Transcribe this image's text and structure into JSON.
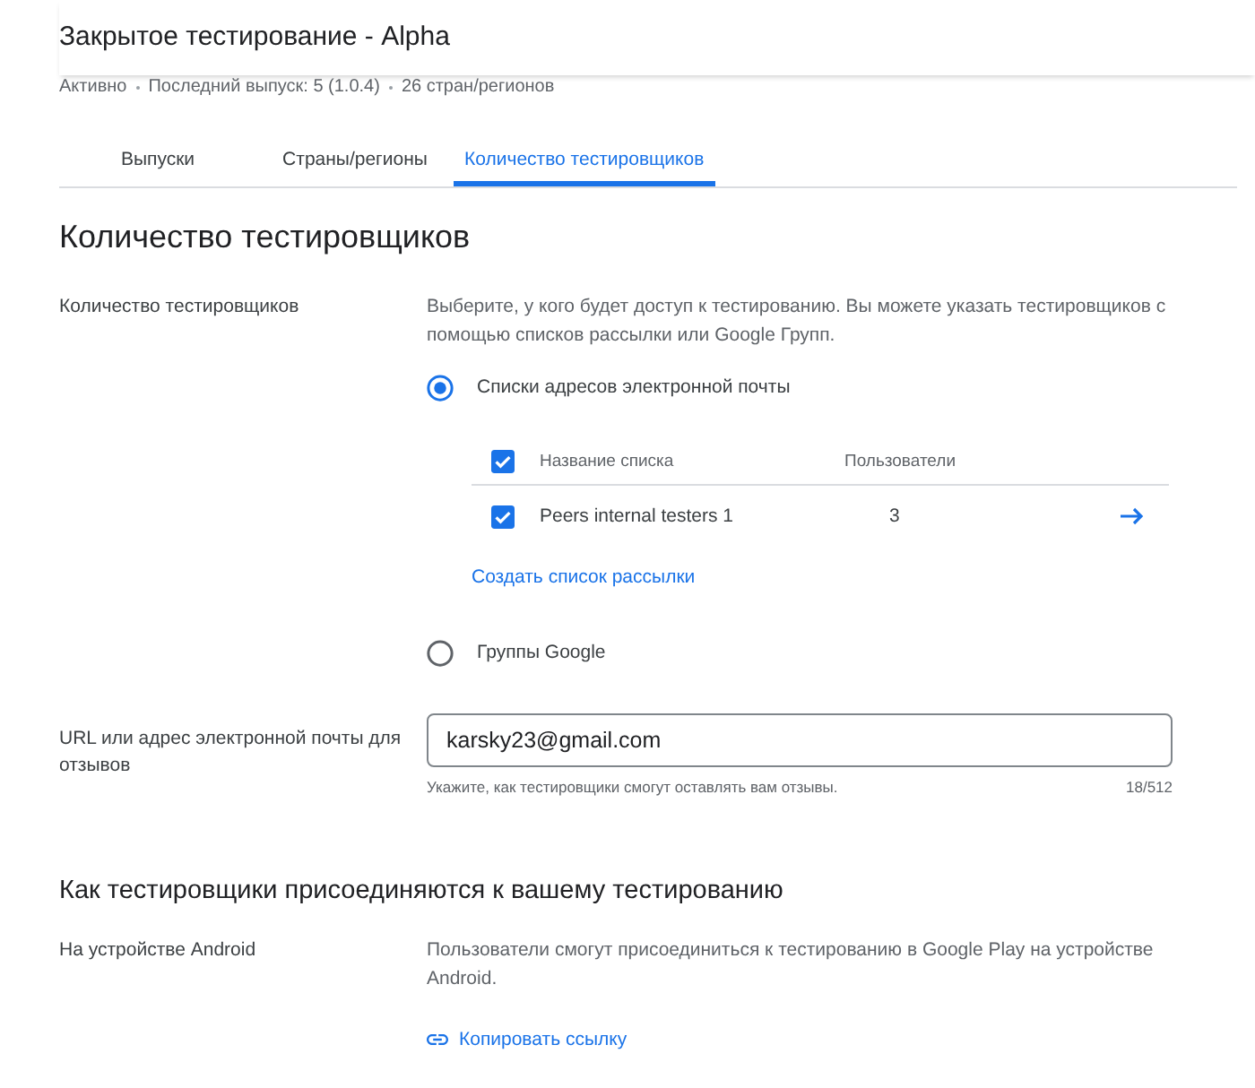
{
  "header": {
    "title": "Закрытое тестирование - Alpha",
    "meta": [
      "Активно",
      "Последний выпуск: 5 (1.0.4)",
      "26 стран/регионов"
    ]
  },
  "tabs": [
    {
      "label": "Выпуски",
      "selected": false
    },
    {
      "label": "Страны/регионы",
      "selected": false
    },
    {
      "label": "Количество тестировщиков",
      "selected": true
    }
  ],
  "testers": {
    "title": "Количество тестировщиков",
    "label": "Количество тестировщиков",
    "description": "Выберите, у кого будет доступ к тестированию. Вы можете указать тестировщиков с помощью списков рассылки или Google Групп.",
    "options": [
      {
        "label": "Списки адресов электронной почты",
        "selected": true,
        "lists": {
          "all_checked": true,
          "columns": [
            "Название списка",
            "Пользователи"
          ],
          "rows": [
            {
              "name": "Peers internal testers 1",
              "users": "3",
              "checked": true
            }
          ],
          "create_link": "Создать список рассылки"
        }
      },
      {
        "label": "Группы Google",
        "selected": false
      }
    ]
  },
  "feedback": {
    "label": "URL или адрес электронной почты для отзывов",
    "value": "karsky23@gmail.com",
    "helper": "Укажите, как тестировщики смогут оставлять вам отзывы.",
    "counter": "18/512"
  },
  "join": {
    "title": "Как тестировщики присоединяются к вашему тестированию",
    "label": "На устройстве Android",
    "description": "Пользователи смогут присоединиться к тестированию в Google Play на устройстве Android.",
    "link": "Копировать ссылку"
  }
}
